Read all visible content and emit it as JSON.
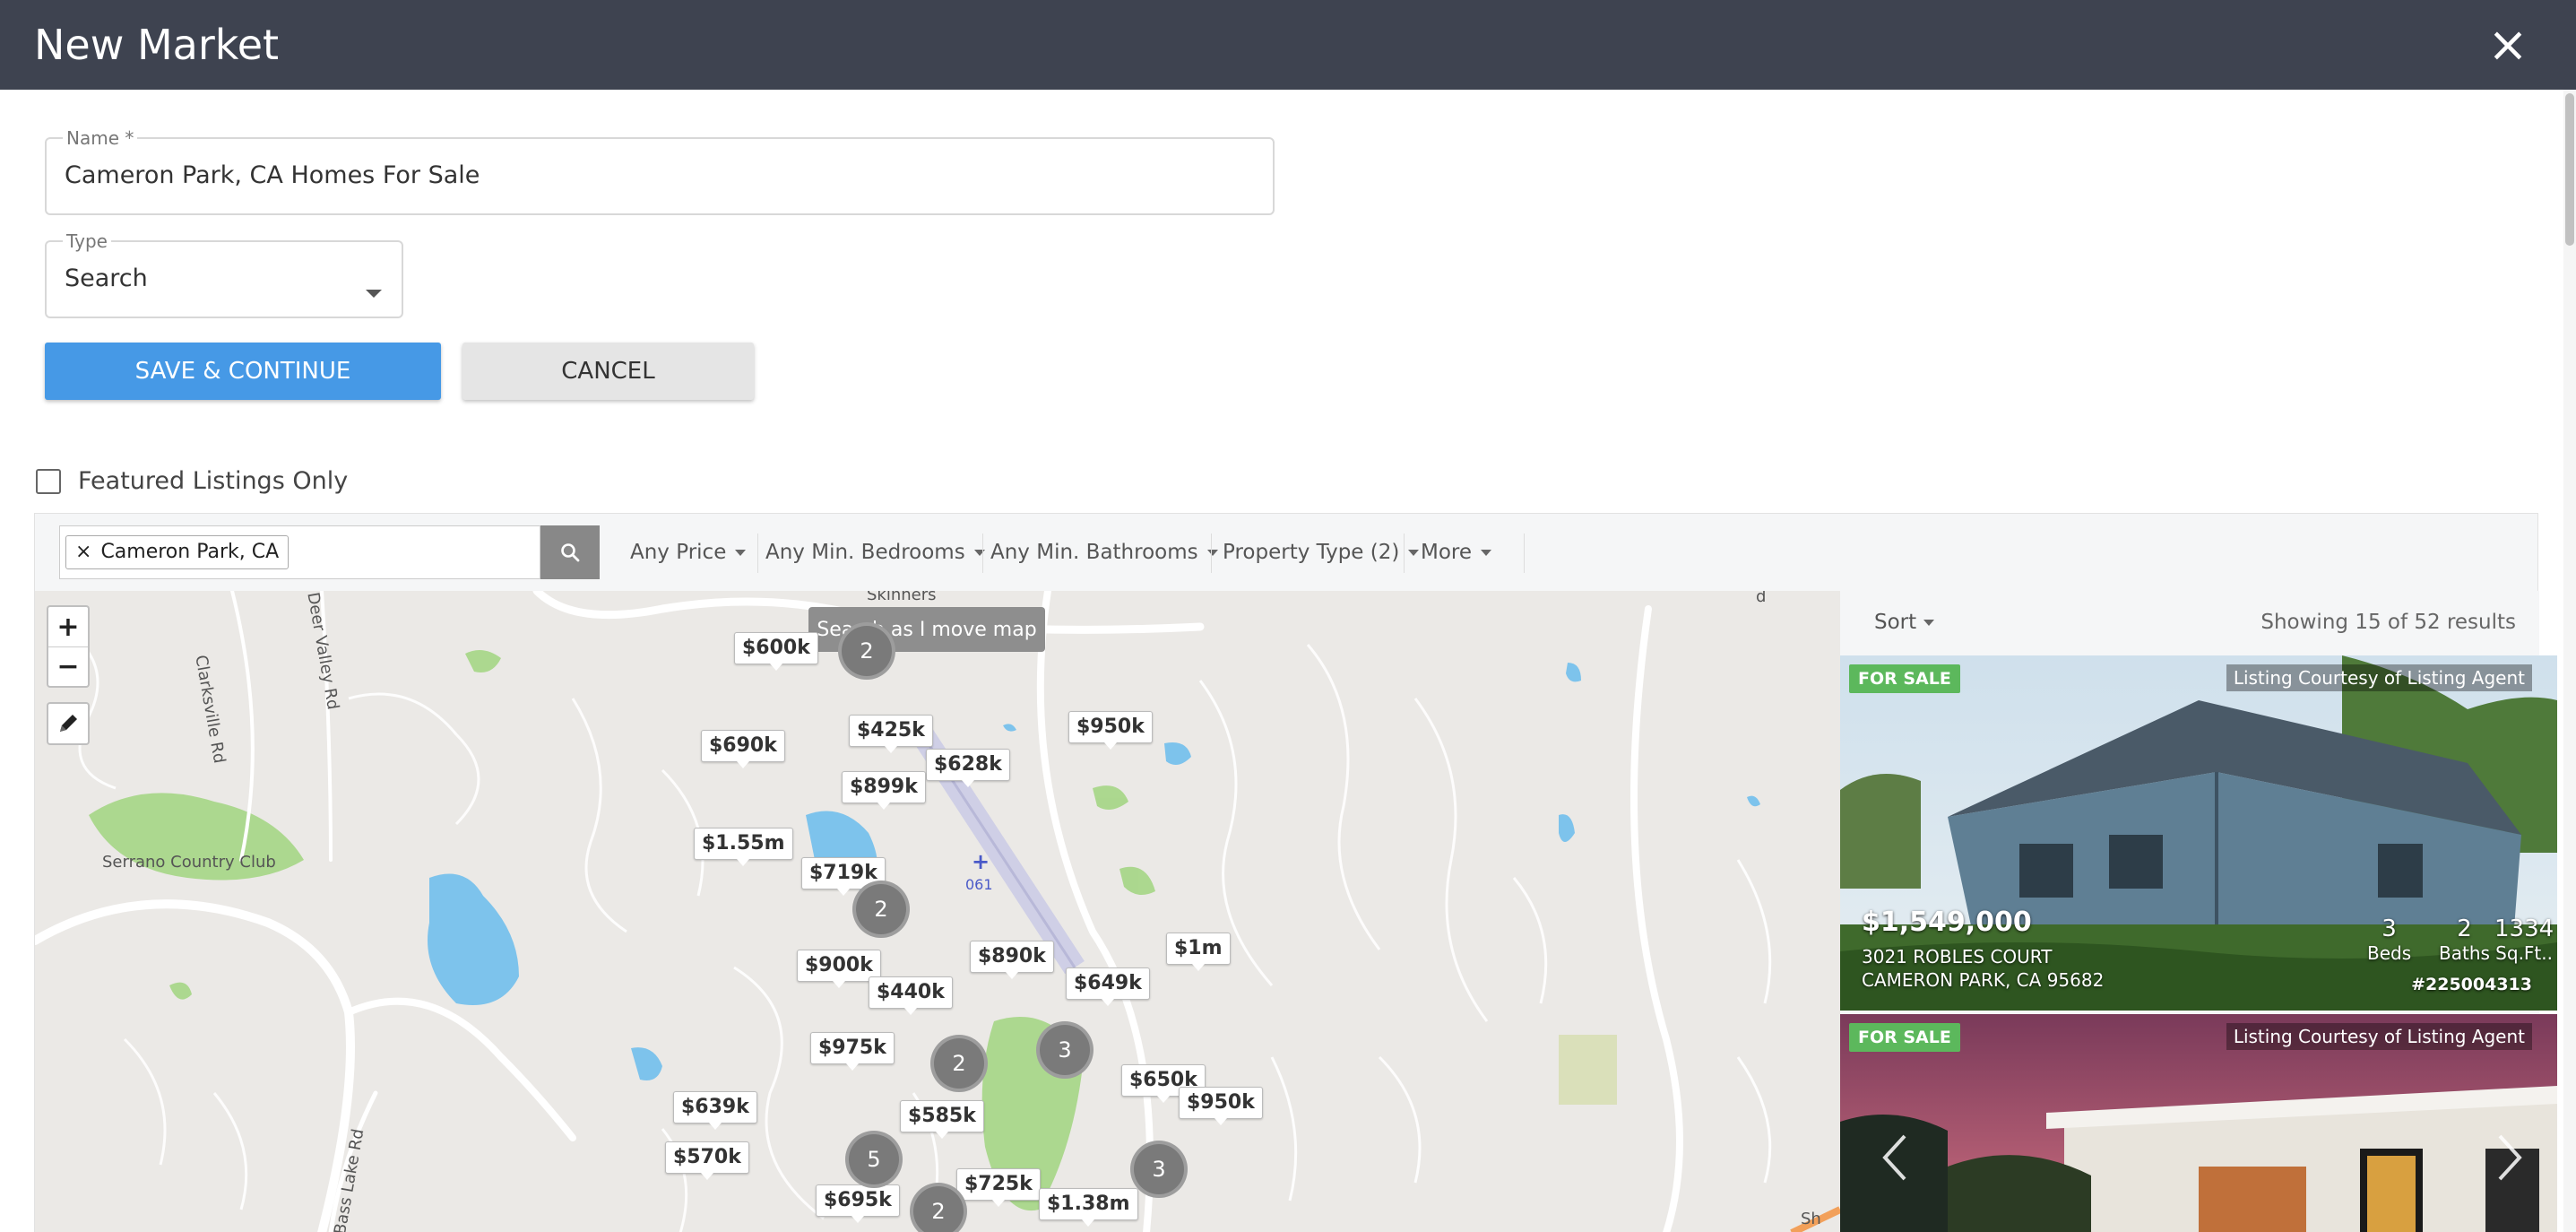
{
  "header": {
    "title": "New Market",
    "close_glyph": "×"
  },
  "form": {
    "name_label": "Name *",
    "name_value": "Cameron Park, CA Homes For Sale",
    "type_label": "Type",
    "type_value": "Search",
    "save_label": "SAVE & CONTINUE",
    "cancel_label": "CANCEL",
    "featured_label": "Featured Listings Only",
    "featured_checked": false
  },
  "search": {
    "location_tag": "Cameron Park, CA",
    "location_remove_glyph": "×",
    "filters": {
      "price": "Any Price",
      "bedrooms": "Any Min. Bedrooms",
      "bathrooms": "Any Min. Bathrooms",
      "property_type": "Property Type (2)",
      "more": "More"
    },
    "search_button_icon": "search-icon"
  },
  "map": {
    "zoom_in": "+",
    "zoom_out": "−",
    "search_as_move": "Search as I move map",
    "labels": {
      "skinners": "Skinners",
      "serrano": "Serrano Country Club",
      "clarksville": "Clarksville Rd",
      "deer_valley": "Deer Valley Rd",
      "bass_lake": "Bass Lake Rd",
      "airport_code": "061",
      "edge_rd": "d",
      "edge_sh": "Sh"
    },
    "price_markers": [
      "$600k",
      "$690k",
      "$425k",
      "$628k",
      "$950k",
      "$899k",
      "$1.55m",
      "$719k",
      "$890k",
      "$1m",
      "$900k",
      "$440k",
      "$649k",
      "$975k",
      "$650k",
      "$950k",
      "$639k",
      "$585k",
      "$570k",
      "$725k",
      "$695k",
      "$1.38m"
    ],
    "clusters": [
      "2",
      "2",
      "2",
      "3",
      "5",
      "3",
      "2"
    ],
    "colors": {
      "water": "#7dc3ec",
      "park": "#a5d685",
      "roads": "#ffffff",
      "land": "#ebe9e6"
    }
  },
  "results": {
    "sort_label": "Sort",
    "showing": "Showing 15 of 52 results",
    "listings": [
      {
        "badge": "FOR SALE",
        "courtesy": "Listing Courtesy of Listing Agent",
        "price": "$1,549,000",
        "street": "3021 ROBLES COURT",
        "city": "CAMERON PARK, CA 95682",
        "beds": "3",
        "beds_label": "Beds",
        "baths": "2",
        "baths_label": "Baths",
        "sqft": "1334",
        "sqft_label": "Sq.Ft..",
        "mls": "#225004313"
      },
      {
        "badge": "FOR SALE",
        "courtesy": "Listing Courtesy of Listing Agent"
      }
    ]
  },
  "colors": {
    "header_bg": "#3e4350",
    "primary": "#4699e6",
    "badge_green": "#5cb85c",
    "cluster": "#7a7a7a"
  }
}
